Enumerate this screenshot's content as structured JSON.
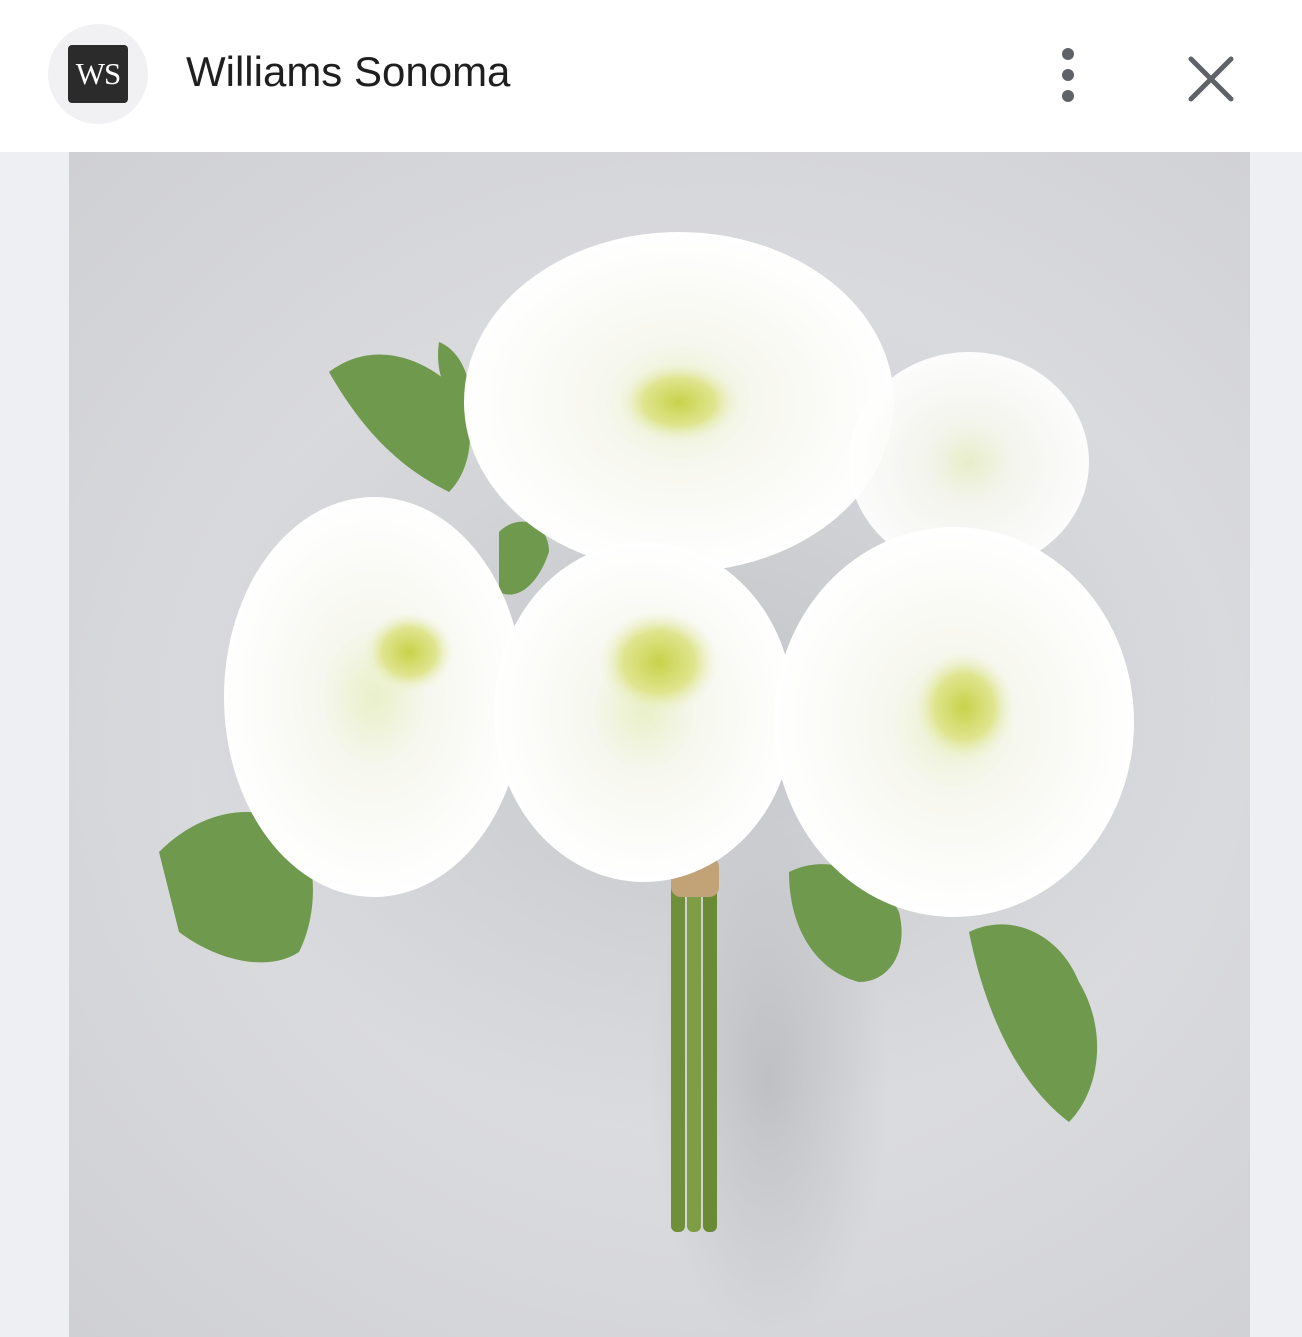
{
  "header": {
    "logo_text": "WS",
    "title": "Williams Sonoma"
  },
  "icons": {
    "menu": "more-vertical-icon",
    "close": "close-icon"
  },
  "colors": {
    "background": "#ffffff",
    "content_background": "#eeeff2",
    "icon_color": "#5f6368",
    "logo_background": "#2b2b2b"
  }
}
